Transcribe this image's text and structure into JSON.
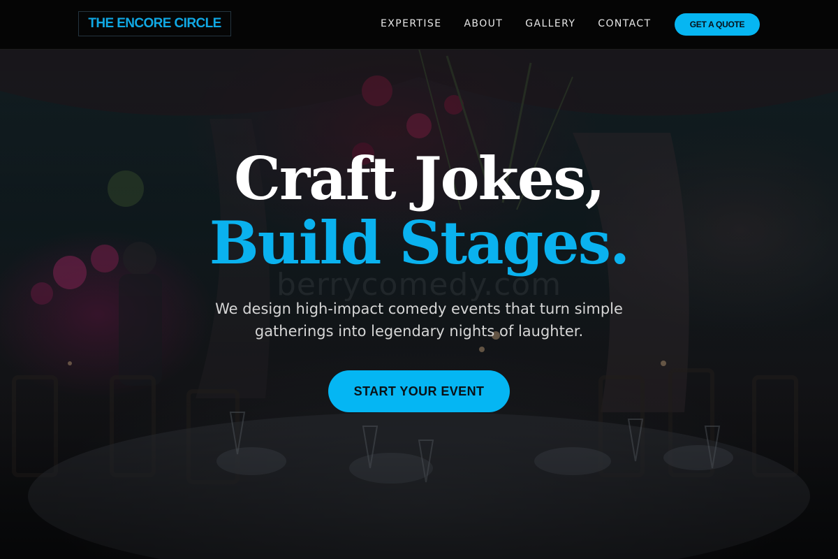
{
  "header": {
    "logo_text": "THE ENCORE CIRCLE",
    "nav": [
      {
        "label": "EXPERTISE"
      },
      {
        "label": "ABOUT"
      },
      {
        "label": "GALLERY"
      },
      {
        "label": "CONTACT"
      }
    ],
    "quote_button": "GET A QUOTE"
  },
  "hero": {
    "headline_line1": "Craft Jokes,",
    "headline_line2": "Build Stages.",
    "watermark": "berrycomedy.com",
    "subtitle": "We design high-impact comedy events that turn simple gatherings into legendary nights of laughter.",
    "cta": "START YOUR EVENT"
  },
  "colors": {
    "accent": "#06b6f2",
    "header_bg": "#050505",
    "headline_white": "#ffffff"
  }
}
